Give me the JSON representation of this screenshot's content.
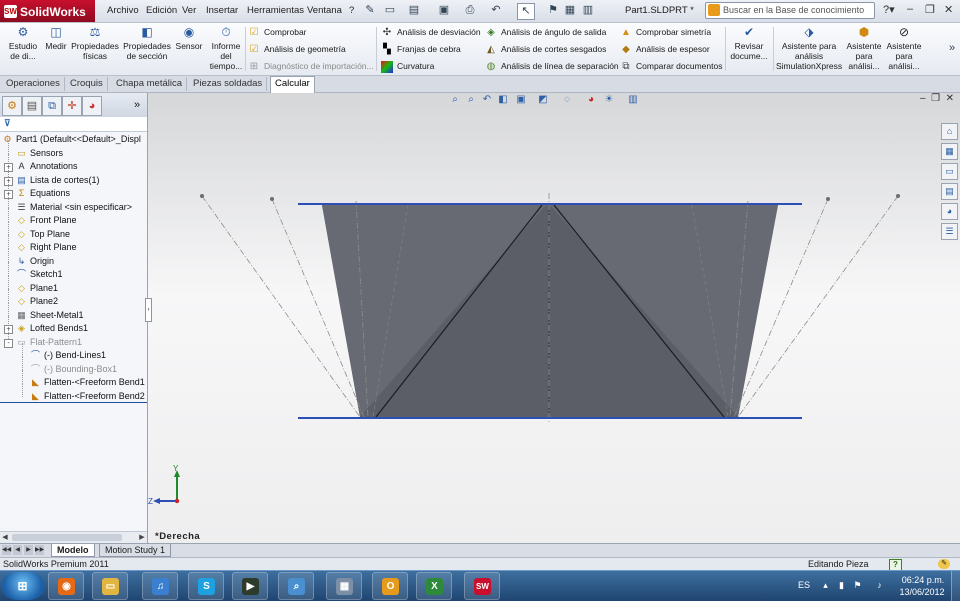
{
  "app": {
    "name": "SolidWorks",
    "logo_mark": "SW",
    "document_title": "Part1.SLDPRT *",
    "brand_color": "#c8102e"
  },
  "menu": {
    "items": [
      "Archivo",
      "Edición",
      "Ver",
      "Insertar",
      "Herramientas",
      "Ventana",
      "?"
    ]
  },
  "search": {
    "placeholder": "Buscar en la Base de conocimiento"
  },
  "command_manager": {
    "large_buttons": [
      {
        "label": "Estudio de di...",
        "icon": "design-study-icon"
      },
      {
        "label": "Medir",
        "icon": "measure-icon"
      },
      {
        "label": "Propiedades físicas",
        "icon": "mass-properties-icon"
      },
      {
        "label": "Propiedades de sección",
        "icon": "section-properties-icon"
      },
      {
        "label": "Sensor",
        "icon": "sensor-icon"
      },
      {
        "label": "Informe del tiempo...",
        "icon": "statistics-icon"
      }
    ],
    "check_group": [
      {
        "label": "Comprobar",
        "icon": "check-icon",
        "enabled": true
      },
      {
        "label": "Análisis de geometría",
        "icon": "geometry-analysis-icon",
        "enabled": true
      },
      {
        "label": "Diagnóstico de importación...",
        "icon": "import-diagnostics-icon",
        "enabled": false
      }
    ],
    "analysis_group_1": [
      {
        "label": "Análisis de desviación",
        "icon": "deviation-analysis-icon"
      },
      {
        "label": "Franjas de cebra",
        "icon": "zebra-stripes-icon"
      },
      {
        "label": "Curvatura",
        "icon": "curvature-icon"
      }
    ],
    "analysis_group_2": [
      {
        "label": "Análisis de ángulo de salida",
        "icon": "draft-analysis-icon"
      },
      {
        "label": "Análisis de cortes sesgados",
        "icon": "undercut-analysis-icon"
      },
      {
        "label": "Análisis de línea de separación",
        "icon": "parting-line-analysis-icon"
      }
    ],
    "analysis_group_3": [
      {
        "label": "Comprobar simetría",
        "icon": "symmetry-check-icon"
      },
      {
        "label": "Análisis de espesor",
        "icon": "thickness-analysis-icon"
      },
      {
        "label": "Comparar documentos",
        "icon": "compare-documents-icon"
      }
    ],
    "right_buttons": [
      {
        "label": "Revisar docume...",
        "icon": "design-checker-icon"
      },
      {
        "label": "Asistente para análisis SimulationXpress",
        "icon": "simulationxpress-icon"
      },
      {
        "label": "Asistente para análisi...",
        "icon": "floxpress-icon"
      },
      {
        "label": "Asistente para análisi...",
        "icon": "dfmxpress-icon"
      }
    ]
  },
  "command_tabs": [
    "Operaciones",
    "Croquis",
    "Chapa metálica",
    "Piezas soldadas",
    "Calcular"
  ],
  "active_command_tab": "Calcular",
  "feature_tree": {
    "nodes": [
      {
        "label": "Part1  (Default<<Default>_Displ",
        "icon": "part-icon",
        "level": 0,
        "expander": "",
        "dim": false
      },
      {
        "label": "Sensors",
        "icon": "sensors-folder-icon",
        "level": 1,
        "expander": "",
        "dim": false
      },
      {
        "label": "Annotations",
        "icon": "annotations-icon",
        "level": 1,
        "expander": "+",
        "dim": false
      },
      {
        "label": "Lista de cortes(1)",
        "icon": "cut-list-icon",
        "level": 1,
        "expander": "+",
        "dim": false
      },
      {
        "label": "Equations",
        "icon": "equations-icon",
        "level": 1,
        "expander": "+",
        "dim": false
      },
      {
        "label": "Material <sin especificar>",
        "icon": "material-icon",
        "level": 1,
        "expander": "",
        "dim": false
      },
      {
        "label": "Front Plane",
        "icon": "plane-icon",
        "level": 1,
        "expander": "",
        "dim": false
      },
      {
        "label": "Top Plane",
        "icon": "plane-icon",
        "level": 1,
        "expander": "",
        "dim": false
      },
      {
        "label": "Right Plane",
        "icon": "plane-icon",
        "level": 1,
        "expander": "",
        "dim": false
      },
      {
        "label": "Origin",
        "icon": "origin-icon",
        "level": 1,
        "expander": "",
        "dim": false
      },
      {
        "label": "Sketch1",
        "icon": "sketch-icon",
        "level": 1,
        "expander": "",
        "dim": false
      },
      {
        "label": "Plane1",
        "icon": "plane-icon",
        "level": 1,
        "expander": "",
        "dim": false
      },
      {
        "label": "Plane2",
        "icon": "plane-icon",
        "level": 1,
        "expander": "",
        "dim": false
      },
      {
        "label": "Sheet-Metal1",
        "icon": "sheet-metal-icon",
        "level": 1,
        "expander": "",
        "dim": false
      },
      {
        "label": "Lofted Bends1",
        "icon": "lofted-bends-icon",
        "level": 1,
        "expander": "+",
        "dim": false
      },
      {
        "label": "Flat-Pattern1",
        "icon": "flat-pattern-icon",
        "level": 1,
        "expander": "-",
        "dim": true
      },
      {
        "label": "(-) Bend-Lines1",
        "icon": "sketch-icon",
        "level": 2,
        "expander": "",
        "dim": false
      },
      {
        "label": "(-) Bounding-Box1",
        "icon": "sketch-icon",
        "level": 2,
        "expander": "",
        "dim": true
      },
      {
        "label": "Flatten-<Freeform Bend1",
        "icon": "flatten-icon",
        "level": 2,
        "expander": "",
        "dim": false
      },
      {
        "label": "Flatten-<Freeform Bend2",
        "icon": "flatten-icon",
        "level": 2,
        "expander": "",
        "dim": false
      }
    ]
  },
  "viewport": {
    "view_name": "*Derecha",
    "triad_labels": {
      "y": "Y",
      "z": "Z"
    },
    "model_fill": "#5b5e66",
    "plane_line_color": "#2b4fb5"
  },
  "bottom_tabs": [
    "Modelo",
    "Motion Study 1"
  ],
  "active_bottom_tab": "Modelo",
  "status": {
    "product": "SolidWorks Premium 2011",
    "mode": "Editando Pieza"
  },
  "taskbar": {
    "apps": [
      {
        "name": "firefox-icon",
        "color": "#e66a16"
      },
      {
        "name": "explorer-icon",
        "color": "#e0b640"
      },
      {
        "name": "itunes-icon",
        "color": "#3b7fd0"
      },
      {
        "name": "skype-icon",
        "color": "#1da1e0"
      },
      {
        "name": "media-icon",
        "color": "#2d3b2b"
      },
      {
        "name": "search-icon",
        "color": "#4a8fd0"
      },
      {
        "name": "calculator-icon",
        "color": "#7d8fa6"
      },
      {
        "name": "outlook-icon",
        "color": "#e59a1b"
      },
      {
        "name": "excel-icon",
        "color": "#2d8a3a"
      },
      {
        "name": "solidworks-icon",
        "color": "#c8102e"
      }
    ],
    "language": "ES",
    "time": "06:24 p.m.",
    "date": "13/06/2012"
  }
}
